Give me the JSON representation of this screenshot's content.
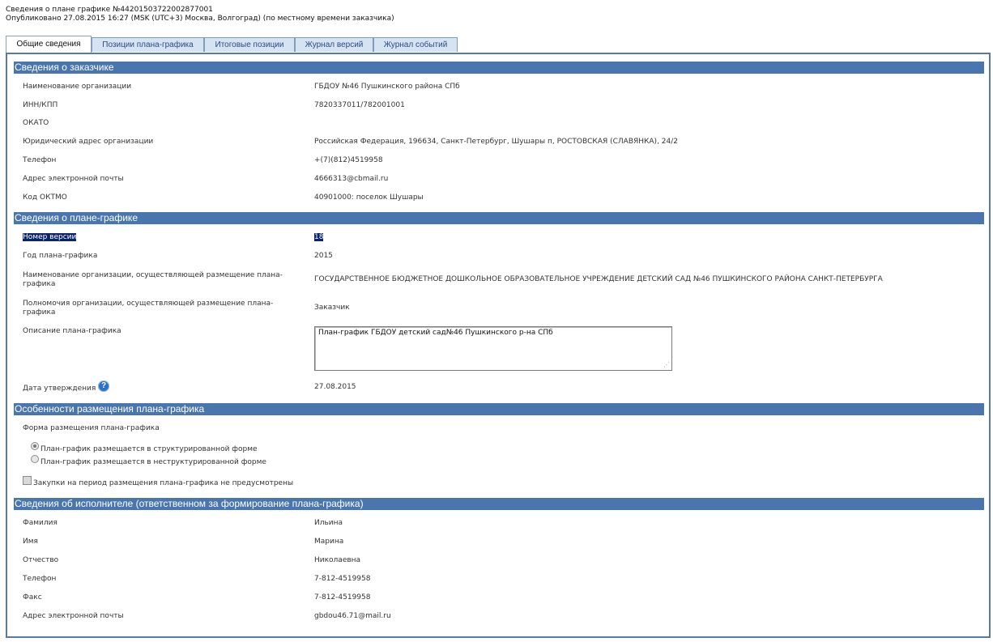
{
  "header": {
    "line1": "Сведения о плане графике №44201503722002877001",
    "line2": "Опубликовано 27.08.2015 16:27 (MSK (UTC+3) Москва, Волгоград) (по местному времени заказчика)"
  },
  "tabs": [
    "Общие сведения",
    "Позиции плана-графика",
    "Итоговые позиции",
    "Журнал версий",
    "Журнал событий"
  ],
  "customer": {
    "title": "Сведения о заказчике",
    "rows": [
      {
        "label": "Наименование организации",
        "value": "ГБДОУ №46 Пушкинского района СПб"
      },
      {
        "label": "ИНН/КПП",
        "value": "7820337011/782001001"
      },
      {
        "label": "ОКАТО",
        "value": ""
      },
      {
        "label": "Юридический адрес организации",
        "value": "Российская Федерация, 196634, Санкт-Петербург, Шушары п, РОСТОВСКАЯ (СЛАВЯНКА), 24/2"
      },
      {
        "label": "Телефон",
        "value": "+(7)(812)4519958"
      },
      {
        "label": "Адрес электронной почты",
        "value": "4666313@cbmail.ru"
      },
      {
        "label": "Код ОКТМО",
        "value": "40901000: поселок Шушары"
      }
    ]
  },
  "plan": {
    "title": "Сведения о плане-графике",
    "version_label": "Номер версии",
    "version_value": "18",
    "year_label": "Год плана-графика",
    "year_value": "2015",
    "org_label_1": "Наименование организации, осуществляющей размещение плана-",
    "org_label_2": "графика",
    "org_value": "ГОСУДАРСТВЕННОЕ БЮДЖЕТНОЕ ДОШКОЛЬНОЕ ОБРАЗОВАТЕЛЬНОЕ УЧРЕЖДЕНИЕ ДЕТСКИЙ САД №46 ПУШКИНСКОГО РАЙОНА САНКТ-ПЕТЕРБУРГА",
    "powers_label_1": "Полномочия организации, осуществляющей размещение плана-",
    "powers_label_2": "графика",
    "powers_value": "Заказчик",
    "desc_label": "Описание плана-графика",
    "desc_value": "План-график ГБДОУ детский сад№46 Пушкинского р-на СПб",
    "date_label": "Дата утверждения",
    "date_value": "27.08.2015"
  },
  "features": {
    "title": "Особенности размещения плана-графика",
    "form_label": "Форма размещения плана-графика",
    "radio_structured": "План-график размещается в структурированной форме",
    "radio_unstructured": "План-график размещается в неструктурированной форме",
    "checkbox_label": "Закупки на период размещения плана-графика не предусмотрены"
  },
  "executor": {
    "title": "Сведения об исполнителе (ответственном за формирование плана-графика)",
    "rows": [
      {
        "label": "Фамилия",
        "value": "Ильина"
      },
      {
        "label": "Имя",
        "value": "Марина"
      },
      {
        "label": "Отчество",
        "value": "Николаевна"
      },
      {
        "label": "Телефон",
        "value": "7-812-4519958"
      },
      {
        "label": "Факс",
        "value": "7-812-4519958"
      },
      {
        "label": "Адрес электронной почты",
        "value": "gbdou46.71@mail.ru"
      }
    ]
  },
  "icons": {
    "help": "?"
  },
  "colors": {
    "section_header": "#4a76b0",
    "panel_border": "#5878a8",
    "tab_bg": "#d6e3f3"
  }
}
